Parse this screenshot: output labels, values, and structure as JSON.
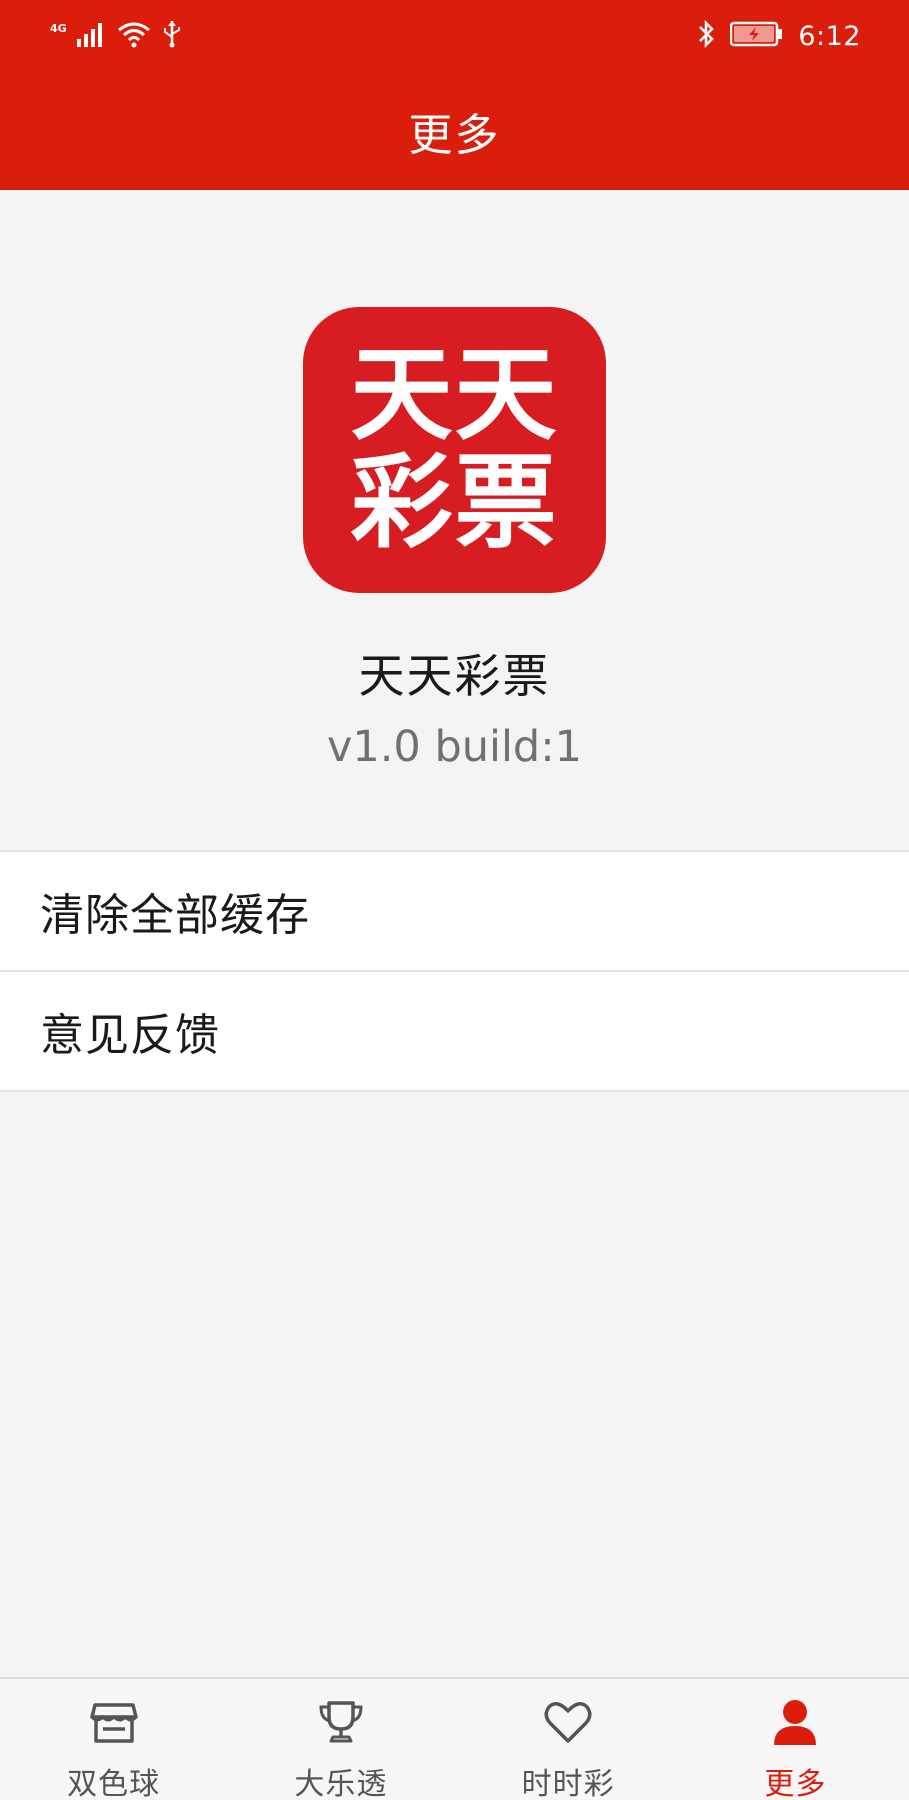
{
  "status_bar": {
    "network": "4G",
    "time": "6:12"
  },
  "header": {
    "title": "更多"
  },
  "app_info": {
    "logo_line1": "天天",
    "logo_line2": "彩票",
    "name": "天天彩票",
    "version": "v1.0 build:1"
  },
  "menu": {
    "items": [
      {
        "label": "清除全部缓存"
      },
      {
        "label": "意见反馈"
      }
    ]
  },
  "tabbar": {
    "tabs": [
      {
        "label": "双色球",
        "icon": "store-icon",
        "active": false
      },
      {
        "label": "大乐透",
        "icon": "trophy-icon",
        "active": false
      },
      {
        "label": "时时彩",
        "icon": "heart-icon",
        "active": false
      },
      {
        "label": "更多",
        "icon": "user-icon",
        "active": true
      }
    ]
  },
  "colors": {
    "brand_red": "#db1e0b",
    "logo_red": "#d71d22",
    "background": "#f4f4f4"
  }
}
